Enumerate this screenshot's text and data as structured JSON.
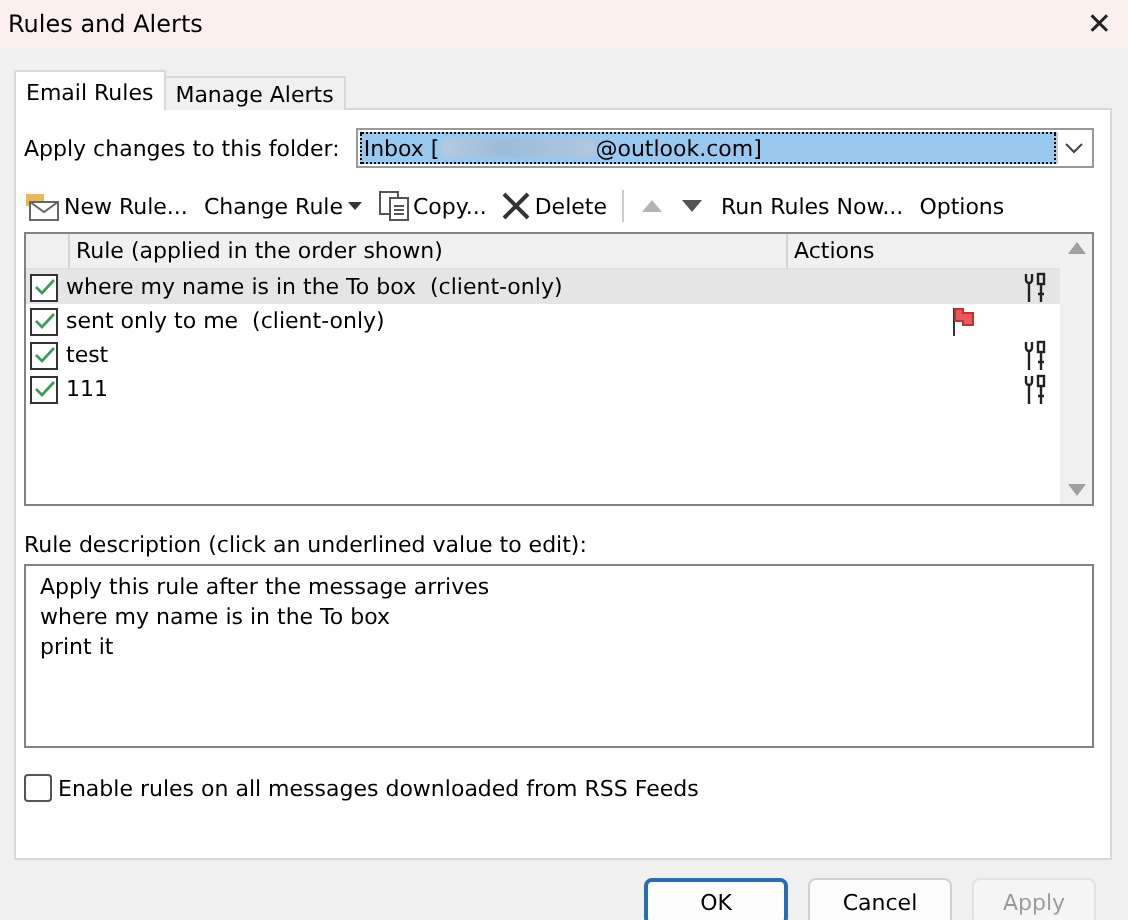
{
  "window": {
    "title": "Rules and Alerts",
    "close": "✕"
  },
  "tabs": [
    {
      "label": "Email Rules",
      "selected": true
    },
    {
      "label": "Manage Alerts",
      "selected": false
    }
  ],
  "folder": {
    "label": "Apply changes to this folder:",
    "value_start": "Inbox [",
    "value_end": "@outlook.com]"
  },
  "toolbar": [
    {
      "kind": "new",
      "label": "New Rule...",
      "disabled": false
    },
    {
      "kind": "change",
      "label": "Change Rule",
      "disabled": false
    },
    {
      "kind": "copy",
      "label": "Copy...",
      "disabled": false
    },
    {
      "kind": "delete",
      "label": "Delete",
      "disabled": false
    },
    {
      "kind": "up",
      "disabled": true
    },
    {
      "kind": "down",
      "disabled": false
    },
    {
      "kind": "run",
      "label": "Run Rules Now...",
      "disabled": false
    },
    {
      "kind": "options",
      "label": "Options",
      "disabled": false
    }
  ],
  "rules_table": {
    "columns": [
      "Rule (applied in the order shown)",
      "Actions"
    ],
    "rows": [
      {
        "rule": "where my name is in the To box  (client-only)",
        "checked": true,
        "selected": true,
        "kind": "tools"
      },
      {
        "rule": "sent only to me  (client-only)",
        "checked": true,
        "selected": false,
        "kind": "flag"
      },
      {
        "rule": "test",
        "checked": true,
        "selected": false,
        "kind": "tools"
      },
      {
        "rule": "111",
        "checked": true,
        "selected": false,
        "kind": "tools"
      }
    ]
  },
  "description": {
    "label": "Rule description (click an underlined value to edit):",
    "lines": [
      "Apply this rule after the message arrives",
      "where my name is in the To box",
      "print it"
    ]
  },
  "rss": {
    "label": "Enable rules on all messages downloaded from RSS Feeds",
    "checked": false
  },
  "buttons": [
    {
      "label": "OK",
      "disabled": false,
      "default": true
    },
    {
      "label": "Cancel",
      "disabled": false,
      "default": false
    },
    {
      "label": "Apply",
      "disabled": true,
      "default": false
    }
  ]
}
